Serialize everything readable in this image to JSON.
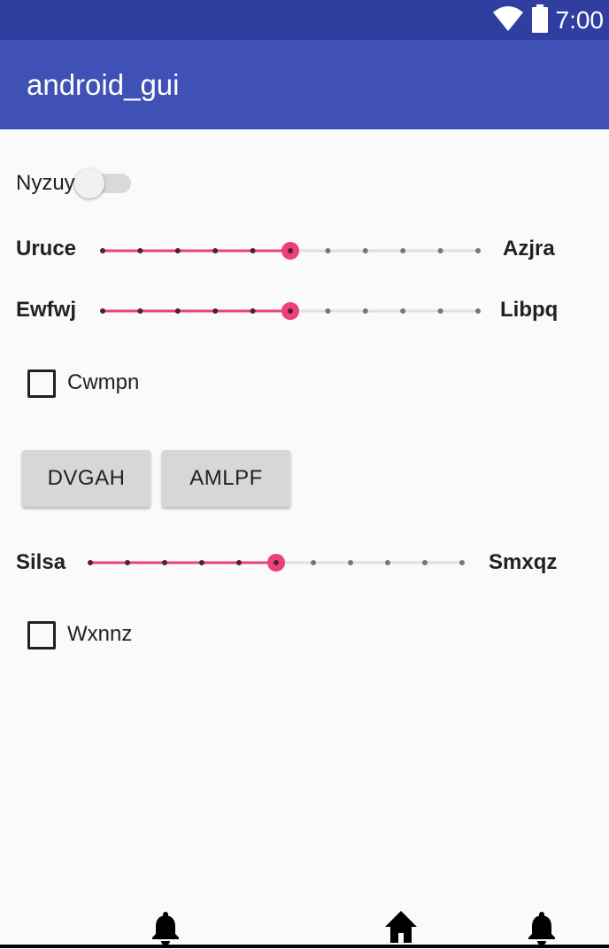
{
  "status_bar": {
    "time": "7:00",
    "icons": [
      "wifi-icon",
      "battery-icon"
    ],
    "background": "#303f9f"
  },
  "app_bar": {
    "title": "android_gui",
    "background": "#3f51b5"
  },
  "toggle": {
    "label": "Nyzuy",
    "checked": false
  },
  "sliders": [
    {
      "left_label": "Uruce",
      "right_label": "Azjra",
      "steps": 10,
      "value": 5
    },
    {
      "left_label": "Ewfwj",
      "right_label": "Libpq",
      "steps": 10,
      "value": 5
    },
    {
      "left_label": "Silsa",
      "right_label": "Smxqz",
      "steps": 10,
      "value": 5
    }
  ],
  "checkboxes": [
    {
      "label": "Cwmpn",
      "checked": false
    },
    {
      "label": "Wxnnz",
      "checked": false
    }
  ],
  "buttons": [
    {
      "label": "DVGAH"
    },
    {
      "label": "AMLPF"
    }
  ],
  "nav_bar": {
    "icons": [
      "bell-icon",
      "home-icon",
      "bell-icon"
    ]
  },
  "accent_color": "#ec407a"
}
